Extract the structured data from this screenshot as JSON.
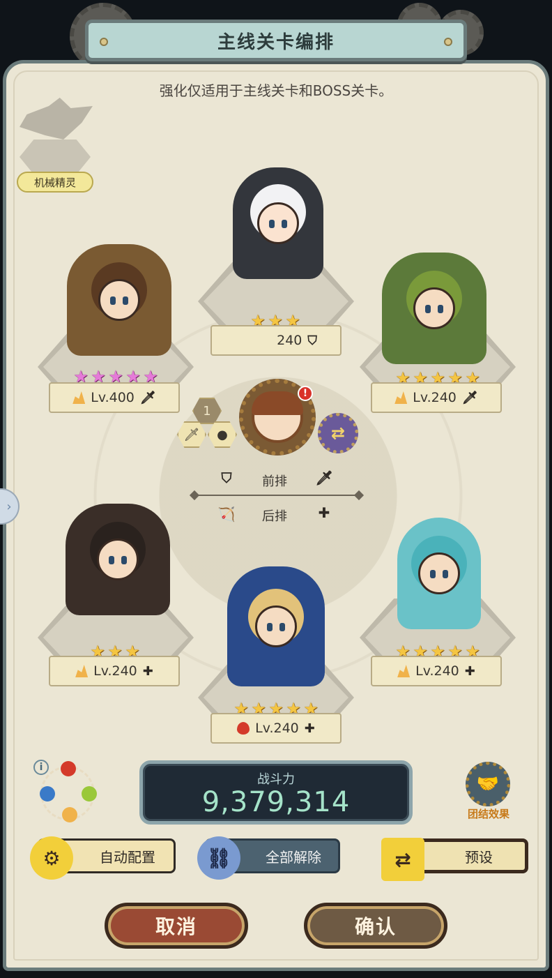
{
  "title": "主线关卡编排",
  "subtitle": "强化仅适用于主线关卡和BOSS关卡。",
  "spirit": {
    "label": "机械精灵"
  },
  "heroes": {
    "top_center": {
      "star_count": 3,
      "star_color": "gold",
      "level": "240",
      "role_icon": "shield-icon"
    },
    "top_left": {
      "star_count": 5,
      "star_color": "pink",
      "level": "Lv.400",
      "role_icon": "sword-icon",
      "element": "earth"
    },
    "top_right": {
      "star_count": 5,
      "star_color": "gold",
      "level": "Lv.240",
      "role_icon": "sword-icon",
      "element": "earth"
    },
    "bottom_left": {
      "star_count": 3,
      "star_color": "gold",
      "level": "Lv.240",
      "role_icon": "plus-icon",
      "element": "earth"
    },
    "bottom_center": {
      "star_count": 5,
      "star_color": "gold",
      "level": "Lv.240",
      "role_icon": "plus-icon",
      "element": "fire"
    },
    "bottom_right": {
      "star_count": 5,
      "star_color": "gold",
      "level": "Lv.240",
      "role_icon": "plus-icon",
      "element": "earth"
    }
  },
  "leader": {
    "slot_number": "1",
    "alert": "!"
  },
  "rows": {
    "front": "前排",
    "back": "后排"
  },
  "power": {
    "label": "战斗力",
    "value": "9,379,314"
  },
  "team_effect": {
    "label": "团结效果"
  },
  "buttons": {
    "auto": "自动配置",
    "release_all": "全部解除",
    "preset": "预设",
    "cancel": "取消",
    "confirm": "确认"
  },
  "colors": {
    "panel_bg": "#ebe6d4",
    "frame": "#6a7b7b",
    "star_gold": "#f4c542",
    "star_pink": "#e57ad8",
    "power_text": "#a5e3c9",
    "cancel_btn": "#9a4a34",
    "confirm_btn": "#6e5a44"
  }
}
